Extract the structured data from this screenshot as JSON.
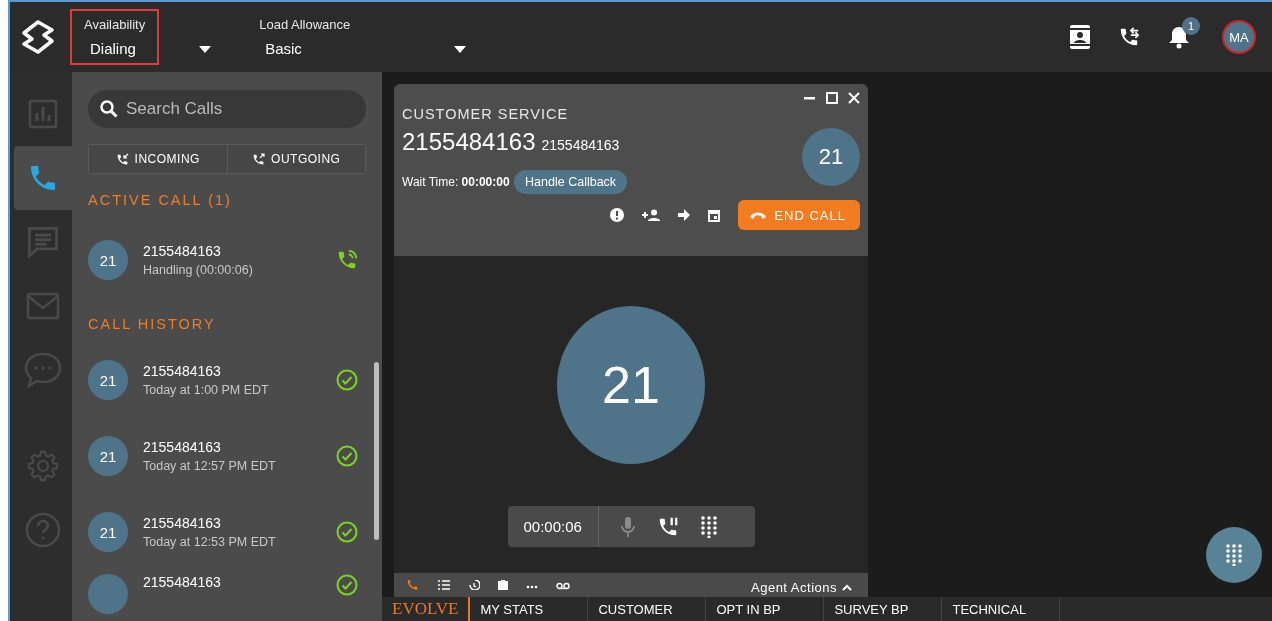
{
  "topbar": {
    "availability": {
      "label": "Availability",
      "value": "Dialing",
      "highlighted": true
    },
    "load_allowance": {
      "label": "Load Allowance",
      "value": "Basic"
    },
    "notification_count": "1",
    "avatar": "MA"
  },
  "rail": [
    {
      "kind": "stats",
      "selected": false
    },
    {
      "kind": "phone",
      "selected": true
    },
    {
      "kind": "messages",
      "selected": false
    },
    {
      "kind": "mail",
      "selected": false
    },
    {
      "kind": "chat",
      "selected": false
    },
    {
      "kind": "settings",
      "selected": false
    },
    {
      "kind": "help",
      "selected": false
    }
  ],
  "sidebar": {
    "search_placeholder": "Search Calls",
    "filters": [
      {
        "label": "INCOMING",
        "kind": "incoming"
      },
      {
        "label": "OUTGOING",
        "kind": "outgoing"
      }
    ],
    "active_heading": "ACTIVE CALL (1)",
    "active_calls": [
      {
        "badge": "21",
        "number": "2155484163",
        "detail": "Handling (00:00:06)",
        "kind": "active"
      }
    ],
    "history_heading": "CALL HISTORY",
    "history": [
      {
        "badge": "21",
        "number": "2155484163",
        "detail": "Today at 1:00 PM EDT",
        "kind": "done"
      },
      {
        "badge": "21",
        "number": "2155484163",
        "detail": "Today at 12:57 PM EDT",
        "kind": "done"
      },
      {
        "badge": "21",
        "number": "2155484163",
        "detail": "Today at 12:53 PM EDT",
        "kind": "done"
      },
      {
        "number": "2155484163",
        "kind": "done"
      }
    ]
  },
  "call_card": {
    "queue": "CUSTOMER SERVICE",
    "number": "2155484163",
    "number_secondary": "2155484163",
    "wait_label": "Wait Time:",
    "wait_value": "00:00:00",
    "badge": "21",
    "tag": "Handle Callback",
    "end_call": "END CALL"
  },
  "call_view": {
    "badge": "21",
    "timer": "00:00:06",
    "muted": true,
    "agent_actions": "Agent Actions"
  },
  "bottom_bar": {
    "logo": "EVOLVE",
    "tabs": [
      "MY STATS",
      "CUSTOMER",
      "OPT IN BP",
      "SURVEY BP",
      "TECHNICAL"
    ]
  }
}
